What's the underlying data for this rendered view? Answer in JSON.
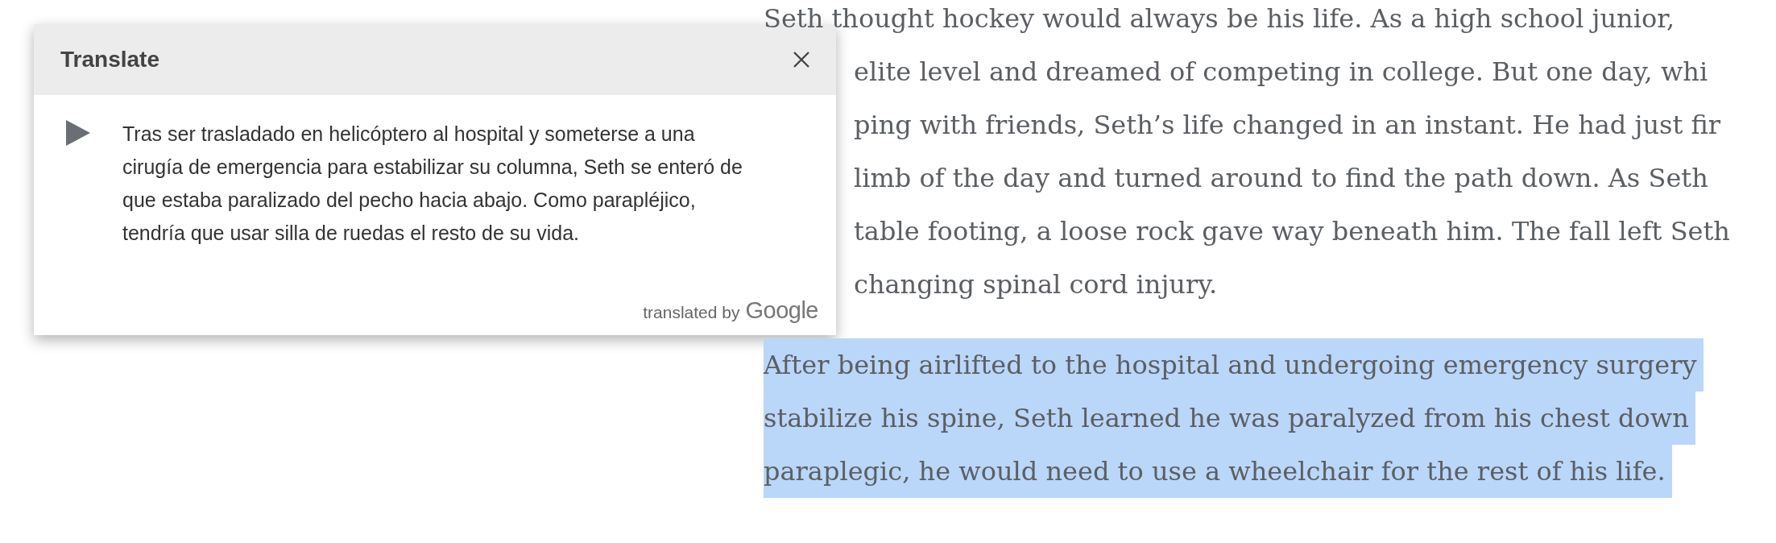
{
  "translate_popup": {
    "title": "Translate",
    "translation": "Tras ser trasladado en helicóptero al hospital y someterse a una cirugía de emergencia para estabilizar su columna, Seth se enteró de que estaba paralizado del pecho hacia abajo. Como parapléjico, tendría que usar silla de ruedas el resto de su vida.",
    "attribution_prefix": "translated by",
    "attribution_brand": "Google"
  },
  "article": {
    "paragraphs": [
      {
        "selected": false,
        "lines": [
          {
            "kind": "full",
            "text": "Seth thought hockey would always be his life. As a high school junior,"
          },
          {
            "kind": "behind-popup",
            "text": "elite level and dreamed of competing in college. But one day, whi"
          },
          {
            "kind": "behind-popup",
            "text": "ping with friends, Seth’s life changed in an instant. He had just fir"
          },
          {
            "kind": "behind-popup",
            "text": "limb of the day and turned around to find the path down. As Seth"
          },
          {
            "kind": "behind-popup",
            "text": "table footing, a loose rock gave way beneath him. The fall left Seth"
          },
          {
            "kind": "behind-popup",
            "text": "changing spinal cord injury."
          }
        ]
      },
      {
        "selected": true,
        "lines": [
          {
            "kind": "full",
            "text": "After being airlifted to the hospital and undergoing emergency surgery"
          },
          {
            "kind": "full",
            "text": "stabilize his spine, Seth learned he was paralyzed from his chest down"
          },
          {
            "kind": "full",
            "text": "paraplegic, he would need to use a wheelchair for the rest of his life."
          }
        ]
      }
    ]
  }
}
